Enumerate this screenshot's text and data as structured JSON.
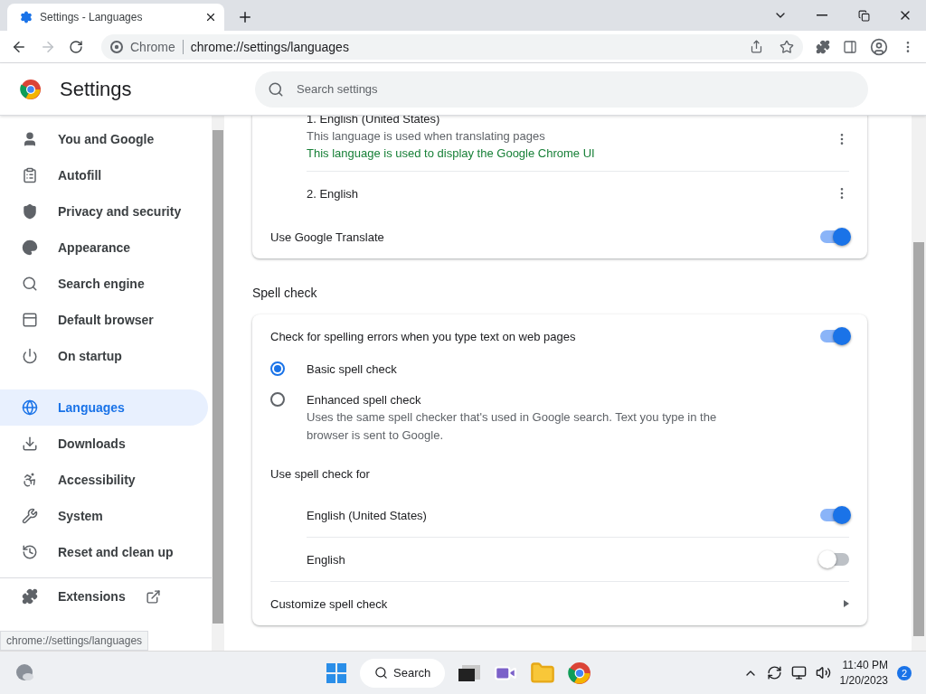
{
  "tab": {
    "title": "Settings - Languages"
  },
  "omnibox": {
    "chip": "Chrome",
    "url": "chrome://settings/languages"
  },
  "header": {
    "title": "Settings",
    "search_placeholder": "Search settings"
  },
  "sidebar": {
    "items": [
      {
        "label": "You and Google",
        "selected": false
      },
      {
        "label": "Autofill",
        "selected": false
      },
      {
        "label": "Privacy and security",
        "selected": false
      },
      {
        "label": "Appearance",
        "selected": false
      },
      {
        "label": "Search engine",
        "selected": false
      },
      {
        "label": "Default browser",
        "selected": false
      },
      {
        "label": "On startup",
        "selected": false
      },
      {
        "label": "Languages",
        "selected": true
      },
      {
        "label": "Downloads",
        "selected": false
      },
      {
        "label": "Accessibility",
        "selected": false
      },
      {
        "label": "System",
        "selected": false
      },
      {
        "label": "Reset and clean up",
        "selected": false
      }
    ],
    "extensions": "Extensions"
  },
  "languages": {
    "items": [
      {
        "name": "1. English (United States)",
        "notes": [
          {
            "text": "This language is used when translating pages",
            "kind": "plain"
          },
          {
            "text": "This language is used to display the Google Chrome UI",
            "kind": "ui"
          }
        ]
      },
      {
        "name": "2. English"
      }
    ],
    "translate": {
      "label": "Use Google Translate",
      "on": true
    }
  },
  "spell_check": {
    "heading": "Spell check",
    "check": {
      "label": "Check for spelling errors when you type text on web pages",
      "on": true
    },
    "modes": [
      {
        "label": "Basic spell check",
        "selected": true
      },
      {
        "label": "Enhanced spell check",
        "description": "Uses the same spell checker that's used in Google search. Text you type in the browser is sent to Google.",
        "selected": false
      }
    ],
    "use_for": "Use spell check for",
    "languages": [
      {
        "label": "English (United States)",
        "on": true
      },
      {
        "label": "English",
        "on": false
      }
    ],
    "customize": "Customize spell check"
  },
  "status_bubble": "chrome://settings/languages",
  "taskbar": {
    "search": "Search",
    "time": "11:40 PM",
    "date": "1/20/2023",
    "badge": "2"
  }
}
